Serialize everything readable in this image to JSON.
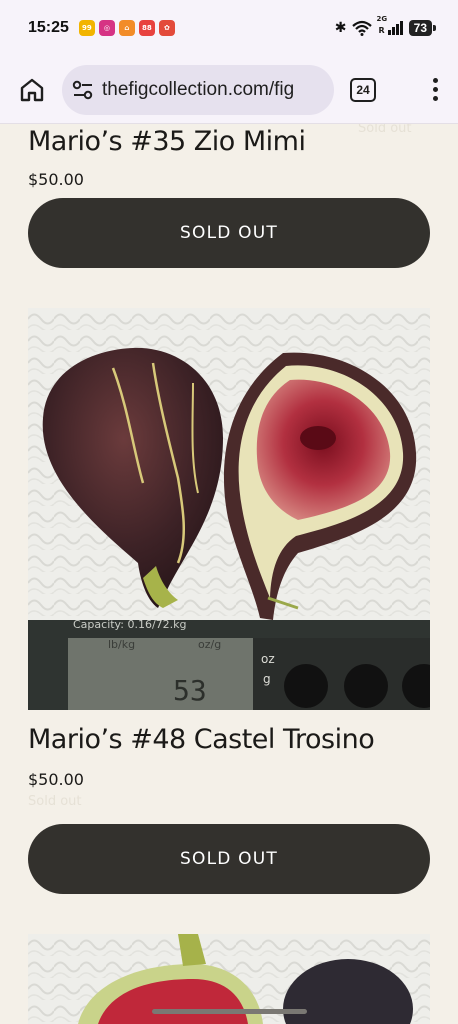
{
  "status_bar": {
    "time": "15:25",
    "notifications": [
      {
        "name": "deal-app-icon",
        "color": "#f2b400",
        "label": "99"
      },
      {
        "name": "instagram-icon",
        "color": "#d63384",
        "label": "◎"
      },
      {
        "name": "link-app-icon",
        "color": "#f28c28",
        "label": "⌂"
      },
      {
        "name": "shop-app-icon",
        "color": "#e8423f",
        "label": "88"
      },
      {
        "name": "gift-app-icon",
        "color": "#e34a3a",
        "label": "✿"
      }
    ],
    "network": "2G",
    "roaming": "R",
    "battery": "73"
  },
  "browser": {
    "url": "thefigcollection.com/fig",
    "tab_count": "24"
  },
  "products": [
    {
      "title": "Mario’s #35 Zio Mimi",
      "price": "$50.00",
      "ghost_label": "Sold out",
      "button": "SOLD OUT"
    },
    {
      "title": "Mario’s #48 Castel Trosino",
      "price": "$50.00",
      "ghost_label": "Sold out",
      "button": "SOLD OUT"
    }
  ],
  "scale_display": {
    "capacity_label": "Capacity: 0.16/72.kg",
    "units_top": "lb/kg",
    "units_right": "oz/g",
    "reading": "53",
    "unit_oz": "oz",
    "unit_g": "g"
  },
  "colors": {
    "page_bg": "#f4f0e8",
    "button_bg": "#33312d",
    "chrome_bg": "#f7f3fa"
  }
}
